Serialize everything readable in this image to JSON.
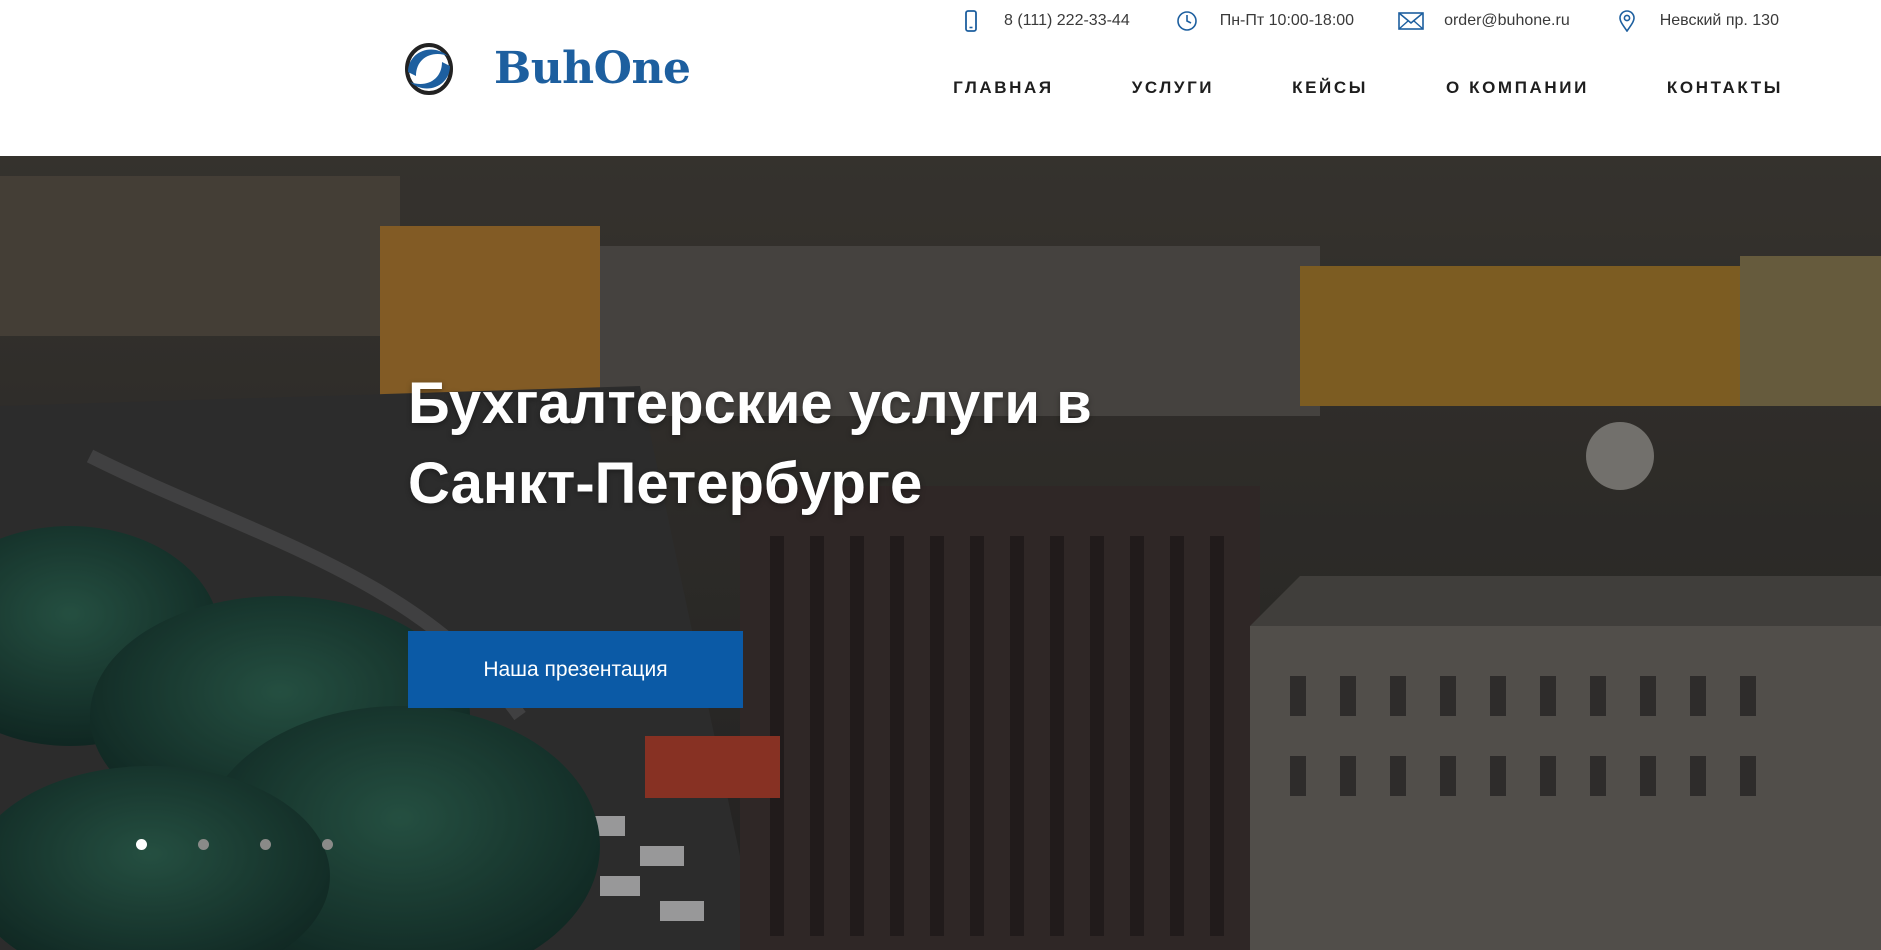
{
  "brand": {
    "name": "BuhOne",
    "logo_icon": "buhone-logo-mark",
    "primary_color": "#1d5f9f"
  },
  "topbar": {
    "contacts": [
      {
        "icon": "phone-icon",
        "text": "8 (111) 222-33-44"
      },
      {
        "icon": "clock-icon",
        "text": "Пн-Пт 10:00-18:00"
      },
      {
        "icon": "mail-icon",
        "text": "order@buhone.ru"
      },
      {
        "icon": "map-pin-icon",
        "text": "Невский пр. 130"
      }
    ]
  },
  "nav": {
    "items": [
      "ГЛАВНАЯ",
      "УСЛУГИ",
      "КЕЙСЫ",
      "О КОМПАНИИ",
      "КОНТАКТЫ"
    ]
  },
  "hero": {
    "title": "Бухгалтерские услуги в Санкт-Петербурге",
    "button_label": "Наша презентация",
    "button_color": "#0b5aa6",
    "slides_total": 4,
    "active_slide": 1
  }
}
